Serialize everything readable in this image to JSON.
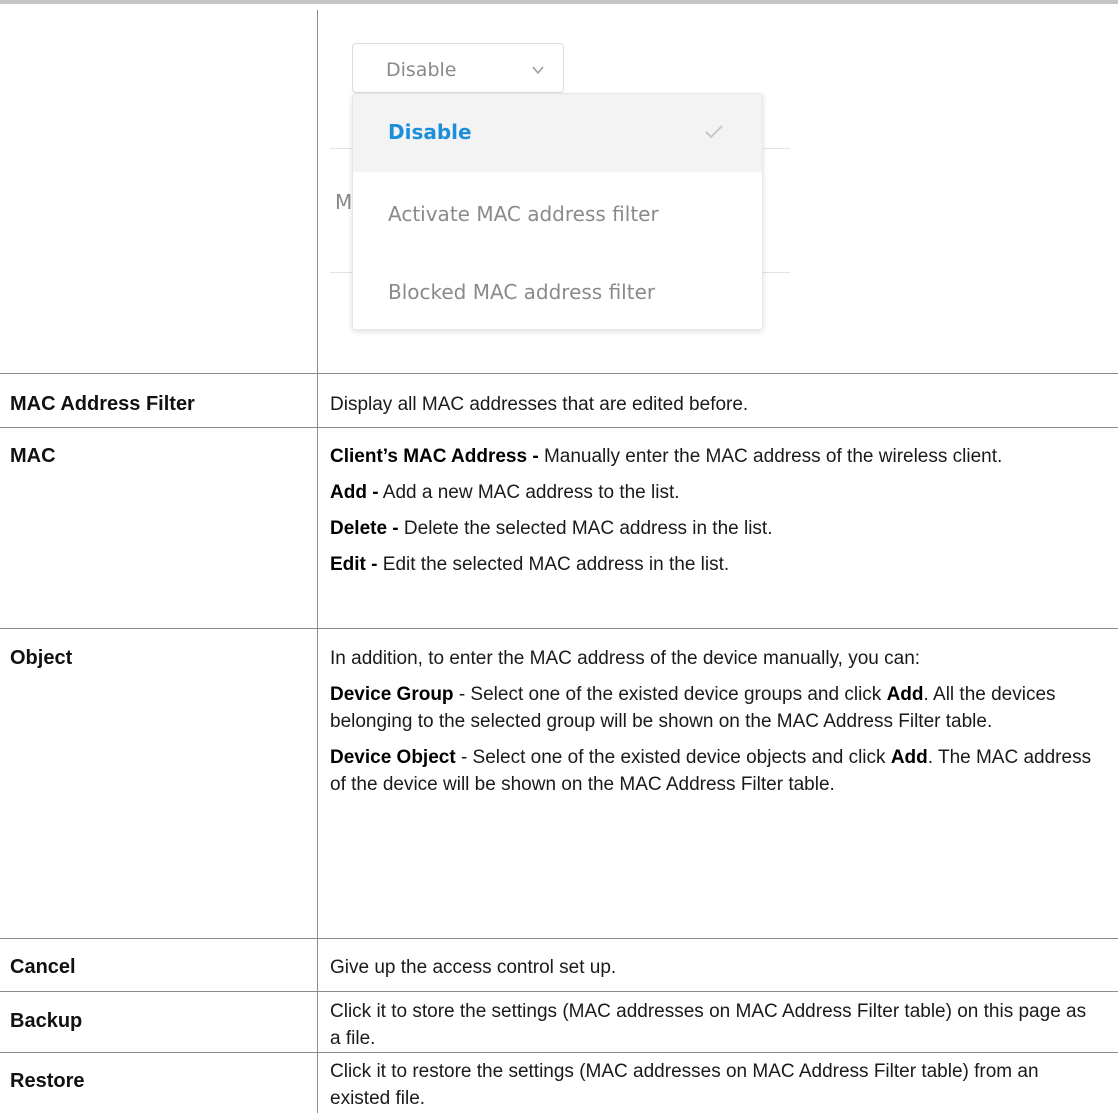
{
  "dropdown": {
    "current_value": "Disable",
    "behind_letter": "M",
    "options": [
      {
        "label": "Disable",
        "selected": true
      },
      {
        "label": "Activate MAC address filter",
        "selected": false
      },
      {
        "label": "Blocked MAC address filter",
        "selected": false
      }
    ],
    "accent_color": "#1c8fd8"
  },
  "rows": [
    {
      "label": "MAC Address Filter",
      "desc": [
        {
          "bold": "",
          "text": "Display all MAC addresses that are edited before."
        }
      ]
    },
    {
      "label": "MAC",
      "desc": [
        {
          "bold": "Client’s MAC Address -",
          "text": " Manually enter the MAC address of the wireless client."
        },
        {
          "bold": "Add -",
          "text": " Add a new MAC address to the list."
        },
        {
          "bold": "Delete -",
          "text": " Delete the selected MAC address in the list."
        },
        {
          "bold": "Edit -",
          "text": " Edit the selected MAC address in the list."
        }
      ]
    },
    {
      "label": "Object",
      "desc": [
        {
          "bold": "",
          "text": "In addition, to enter the MAC address of the device manually, you can:"
        },
        {
          "bold": "Device Group",
          "text": " - Select one of the existed device groups and click ",
          "bold2": "Add",
          "text2": ". All the devices belonging to the selected group will be shown on the MAC Address Filter table."
        },
        {
          "bold": "Device Object",
          "text": " - Select one of the existed device objects and click ",
          "bold2": "Add",
          "text2": ". The MAC address of the device will be shown on the MAC Address Filter table."
        }
      ]
    },
    {
      "label": "Cancel",
      "desc": [
        {
          "bold": "",
          "text": "Give up the access control set up."
        }
      ]
    },
    {
      "label": "Backup",
      "desc": [
        {
          "bold": "",
          "text": "Click it to store the settings (MAC addresses on MAC Address Filter table) on this page as a file."
        }
      ]
    },
    {
      "label": "Restore",
      "desc": [
        {
          "bold": "",
          "text": "Click it to restore the settings (MAC addresses on MAC Address Filter table) from an existed file."
        }
      ]
    }
  ]
}
